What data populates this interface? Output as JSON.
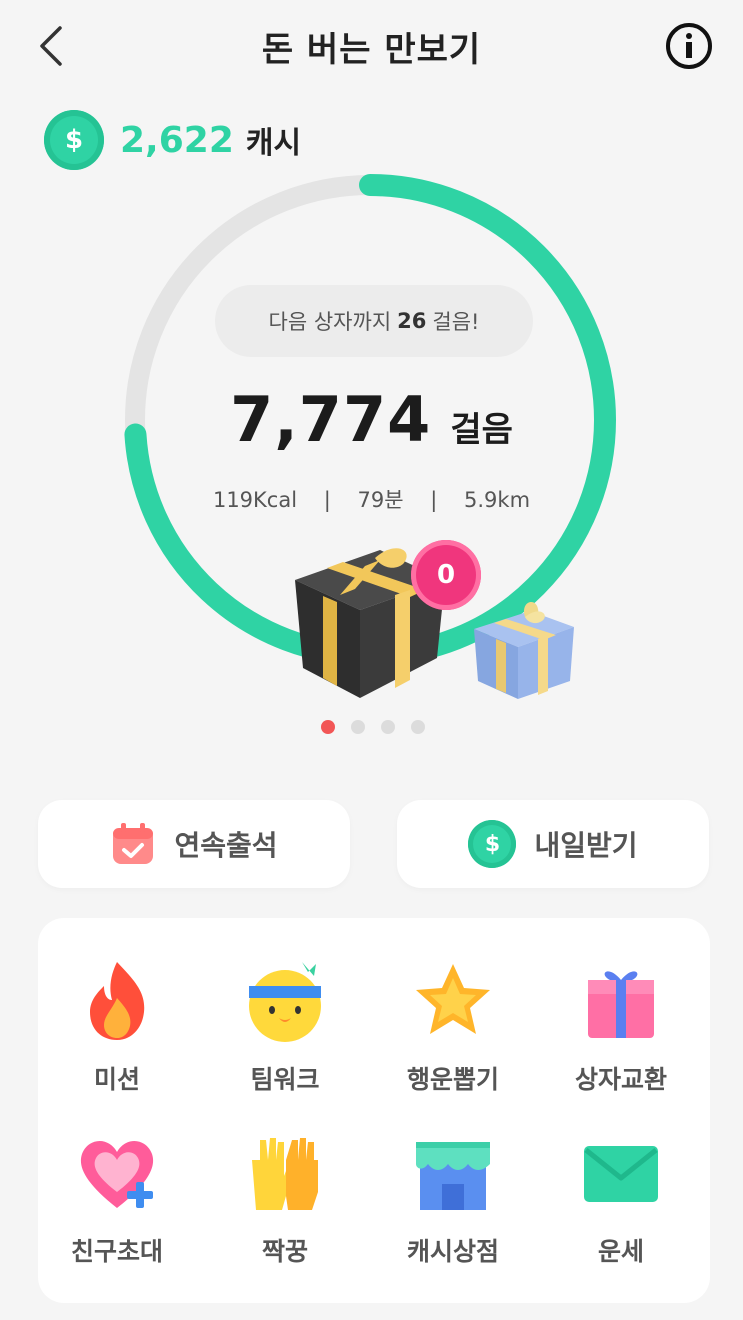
{
  "header": {
    "title": "돈 버는 만보기"
  },
  "cash": {
    "amount": "2,622",
    "unit": "캐시",
    "coin_symbol": "$"
  },
  "progress": {
    "next_prefix": "다음 상자까지",
    "next_count": "26",
    "next_suffix": "걸음!",
    "ring_fraction": 0.74,
    "ring_color": "#2fd3a4"
  },
  "steps": {
    "count": "7,774",
    "unit": "걸음"
  },
  "stats": {
    "kcal": "119Kcal",
    "sep": "|",
    "minutes": "79분",
    "distance": "5.9km"
  },
  "gift_badge": "0",
  "pager": {
    "pages": 4,
    "active": 0
  },
  "buttons": {
    "attendance": "연속출석",
    "tomorrow": "내일받기",
    "coin_symbol": "$"
  },
  "grid": {
    "items": [
      {
        "label": "미션",
        "icon": "fire-icon"
      },
      {
        "label": "팀워크",
        "icon": "character-headband-icon"
      },
      {
        "label": "행운뽑기",
        "icon": "star-icon"
      },
      {
        "label": "상자교환",
        "icon": "gift-box-icon"
      },
      {
        "label": "친구초대",
        "icon": "heart-plus-icon"
      },
      {
        "label": "짝꿍",
        "icon": "high-five-hands-icon"
      },
      {
        "label": "캐시상점",
        "icon": "store-icon"
      },
      {
        "label": "운세",
        "icon": "envelope-icon"
      }
    ]
  }
}
